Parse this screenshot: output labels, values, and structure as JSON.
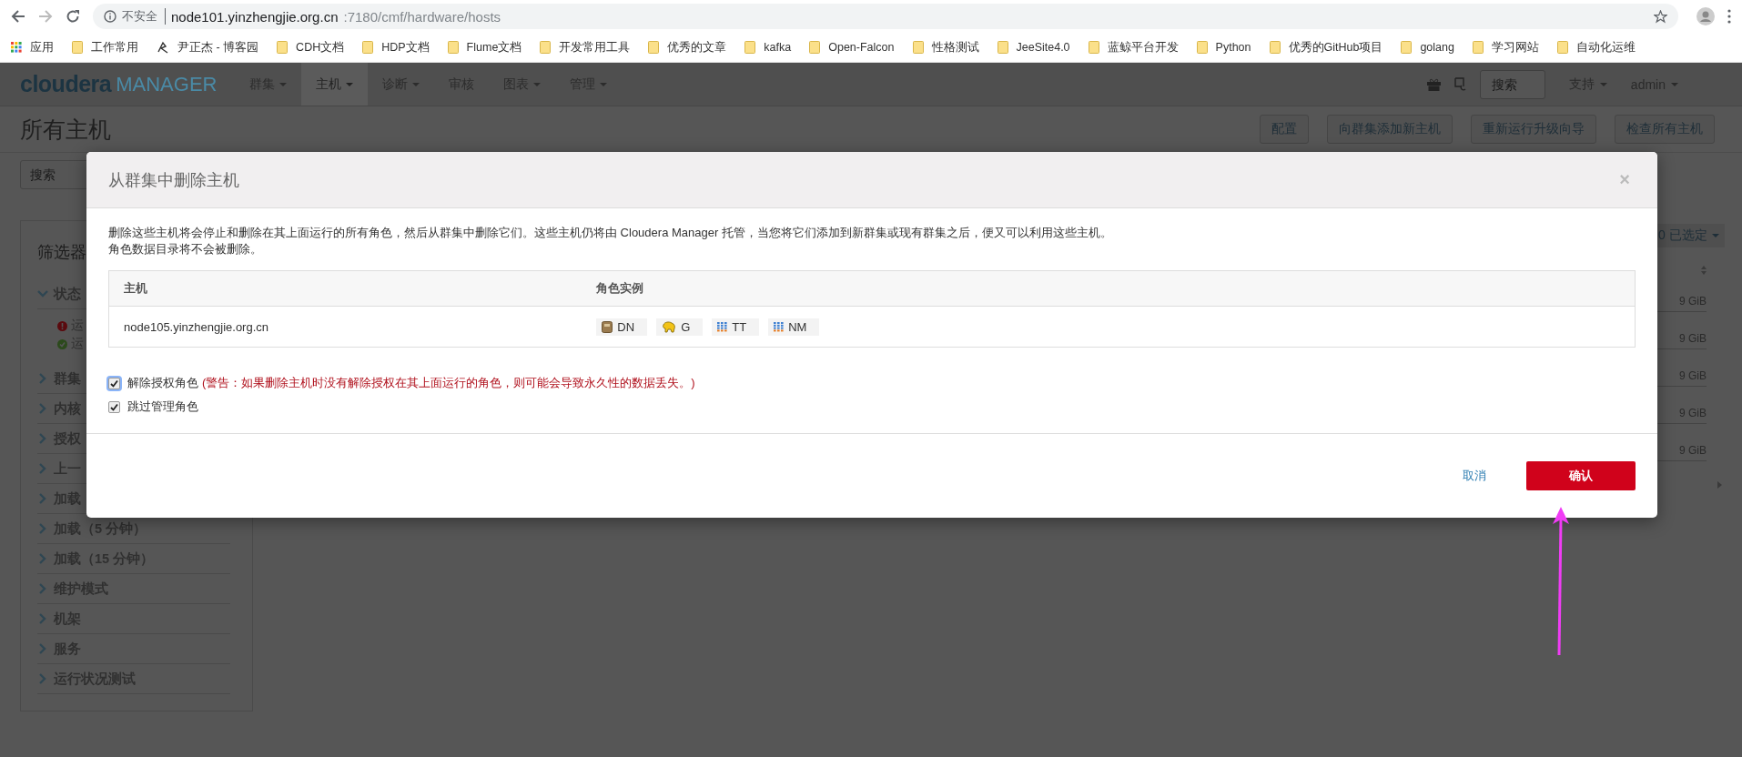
{
  "browser": {
    "security": "不安全",
    "url_host": "node101.yinzhengjie.org.cn",
    "url_path": ":7180/cmf/hardware/hosts"
  },
  "bookmarks": [
    {
      "label": "应用",
      "kind": "apps"
    },
    {
      "label": "工作常用",
      "kind": "folder"
    },
    {
      "label": "尹正杰 - 博客园",
      "kind": "site"
    },
    {
      "label": "CDH文档",
      "kind": "folder"
    },
    {
      "label": "HDP文档",
      "kind": "folder"
    },
    {
      "label": "Flume文档",
      "kind": "folder"
    },
    {
      "label": "开发常用工具",
      "kind": "folder"
    },
    {
      "label": "优秀的文章",
      "kind": "folder"
    },
    {
      "label": "kafka",
      "kind": "folder"
    },
    {
      "label": "Open-Falcon",
      "kind": "folder"
    },
    {
      "label": "性格测试",
      "kind": "folder"
    },
    {
      "label": "JeeSite4.0",
      "kind": "folder"
    },
    {
      "label": "蓝鲸平台开发",
      "kind": "folder"
    },
    {
      "label": "Python",
      "kind": "folder"
    },
    {
      "label": "优秀的GitHub项目",
      "kind": "folder"
    },
    {
      "label": "golang",
      "kind": "folder"
    },
    {
      "label": "学习网站",
      "kind": "folder"
    },
    {
      "label": "自动化运维",
      "kind": "folder"
    }
  ],
  "app": {
    "logo_brand": "cloudera",
    "logo_product": "MANAGER",
    "nav": [
      {
        "label": "群集",
        "dropdown": true,
        "selected": false
      },
      {
        "label": "主机",
        "dropdown": true,
        "selected": true
      },
      {
        "label": "诊断",
        "dropdown": true,
        "selected": false
      },
      {
        "label": "审核",
        "dropdown": false,
        "selected": false
      },
      {
        "label": "图表",
        "dropdown": true,
        "selected": false
      },
      {
        "label": "管理",
        "dropdown": true,
        "selected": false
      }
    ],
    "search": {
      "placeholder": "搜索"
    },
    "menus": [
      "支持",
      "admin"
    ]
  },
  "page": {
    "title": "所有主机",
    "actions": [
      "配置",
      "向群集添加新主机",
      "重新运行升级向导",
      "检查所有主机"
    ],
    "search": {
      "placeholder": "搜索"
    }
  },
  "filters": {
    "title": "筛选器",
    "status": {
      "label": "状态",
      "expanded": true,
      "items": [
        {
          "label": "运",
          "kind": "bad"
        },
        {
          "label": "运",
          "kind": "good"
        }
      ]
    },
    "groups": [
      {
        "label": "群集",
        "expanded": false
      },
      {
        "label": "内核",
        "expanded": false
      },
      {
        "label": "授权",
        "expanded": false
      },
      {
        "label": "上一",
        "expanded": false
      },
      {
        "label": "加载",
        "expanded": false
      },
      {
        "label": "加载（5 分钟）",
        "expanded": false
      },
      {
        "label": "加载（15 分钟）",
        "expanded": false
      },
      {
        "label": "维护模式",
        "expanded": false
      },
      {
        "label": "机架",
        "expanded": false
      },
      {
        "label": "服务",
        "expanded": false
      },
      {
        "label": "运行状况测试",
        "expanded": false
      }
    ]
  },
  "hosts_panel": {
    "selection": "0 已选定",
    "cells": [
      "9 GiB",
      "9 GiB",
      "9 GiB",
      "9 GiB",
      "9 GiB"
    ]
  },
  "dialog": {
    "title": "从群集中删除主机",
    "close": "×",
    "message": [
      "删除这些主机将会停止和删除在其上面运行的所有角色，然后从群集中删除它们。这些主机仍将由 Cloudera Manager 托管，当您将它们添加到新群集或现有群集之后，便又可以利用这些主机。",
      "角色数据目录将不会被删除。"
    ],
    "table": {
      "columns": [
        "主机",
        "角色实例"
      ],
      "rows": [
        {
          "host": "node105.yinzhengjie.org.cn",
          "roles": [
            {
              "label": "DN",
              "kind": "disk"
            },
            {
              "label": "G",
              "kind": "elephant"
            },
            {
              "label": "TT",
              "kind": "grid"
            },
            {
              "label": "NM",
              "kind": "grid"
            }
          ]
        }
      ]
    },
    "options": [
      {
        "label": "解除授权角色",
        "warning": "(警告：如果删除主机时没有解除授权在其上面运行的角色，则可能会导致永久性的数据丢失。)",
        "checked": true,
        "focused": true
      },
      {
        "label": "跳过管理角色",
        "checked": true,
        "focused": false
      }
    ],
    "cancel": "取消",
    "confirm": "确认"
  }
}
